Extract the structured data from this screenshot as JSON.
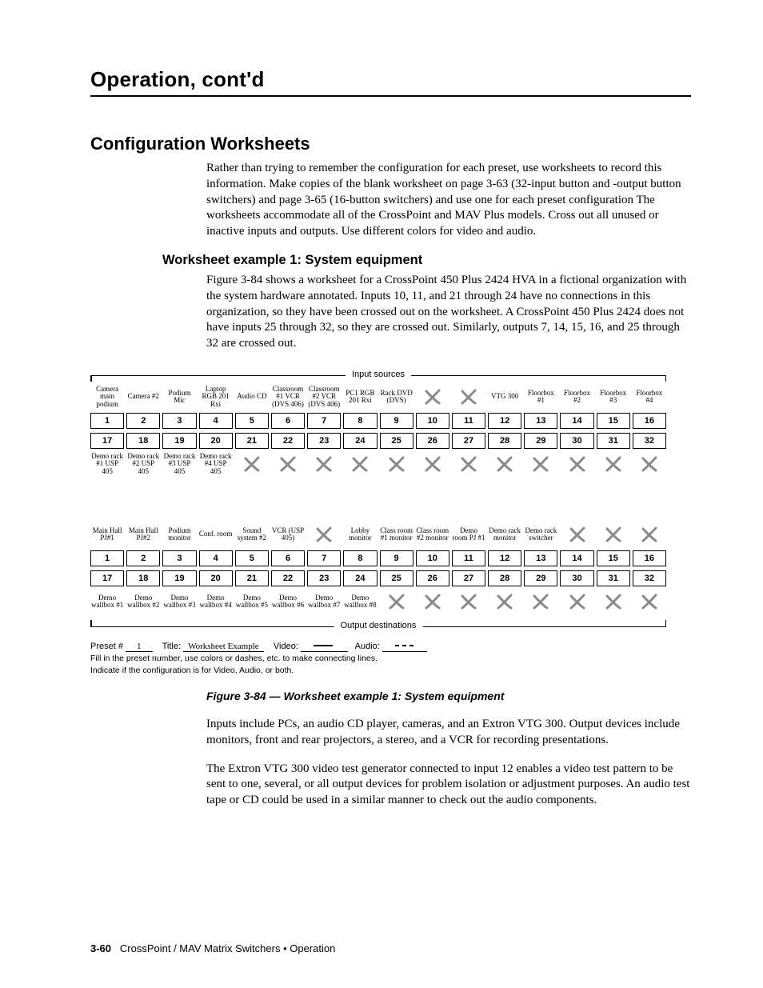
{
  "header": {
    "title": "Operation, cont'd"
  },
  "sec": {
    "h2": "Configuration Worksheets",
    "p1": "Rather than trying to remember the configuration for each preset, use worksheets to record this information.  Make copies of the blank worksheet on page 3-63 (32-input button and -output button switchers) and page 3-65 (16-button switchers) and use one for each preset configuration  The worksheets accommodate all of the CrossPoint and MAV Plus models.  Cross out all unused or inactive inputs and outputs.  Use different colors for video and audio.",
    "h3": "Worksheet example 1: System equipment",
    "p2": "Figure 3-84 shows a worksheet for a CrossPoint 450 Plus 2424 HVA in a fictional organization with the system hardware annotated.  Inputs 10, 11, and 21 through 24 have no connections in this organization, so they have been crossed out on the worksheet.  A CrossPoint 450 Plus 2424 does not have inputs 25 through 32, so they are crossed out.  Similarly, outputs 7, 14, 15, 16, and 25 through 32 are crossed out.",
    "caption": "Figure 3-84 — Worksheet example 1: System equipment",
    "p3": "Inputs include PCs, an audio CD player, cameras, and an Extron VTG 300.  Output devices include monitors, front and rear projectors, a stereo, and a VCR for recording presentations.",
    "p4": "The Extron VTG 300 video test generator connected to input 12 enables a video test pattern to be sent to one, several, or all output devices for problem isolation or adjustment purposes.  An audio test tape or CD could be used in a similar manner to check out the audio components."
  },
  "ws": {
    "input_lbl": "Input sources",
    "output_lbl": "Output destinations",
    "input_top": [
      "Camera main podium",
      "Camera #2",
      "Podium Mic",
      "Laptop RGB 201 Rxi",
      "Audio CD",
      "Classroom #1 VCR (DVS 406)",
      "Classroom #2 VCR (DVS 406)",
      "PC1 RGB 201 Rxi",
      "Rack DVD (DVS)",
      "X",
      "X",
      "VTG 300",
      "Floorbox #1",
      "Floorbox #2",
      "Floorbox #3",
      "Floorbox #4"
    ],
    "row1": [
      "1",
      "2",
      "3",
      "4",
      "5",
      "6",
      "7",
      "8",
      "9",
      "10",
      "11",
      "12",
      "13",
      "14",
      "15",
      "16"
    ],
    "row2": [
      "17",
      "18",
      "19",
      "20",
      "21",
      "22",
      "23",
      "24",
      "25",
      "26",
      "27",
      "28",
      "29",
      "30",
      "31",
      "32"
    ],
    "input_bot": [
      "Demo rack #1 USP 405",
      "Demo rack #2 USP 405",
      "Demo rack #3 USP 405",
      "Demo rack #4 USP 405",
      "X",
      "X",
      "X",
      "X",
      "X",
      "X",
      "X",
      "X",
      "X",
      "X",
      "X",
      "X"
    ],
    "output_top": [
      "Main Hall PJ#1",
      "Main Hall PJ#2",
      "Podium monitor",
      "Conf. room",
      "Sound system #2",
      "VCR (USP 405)",
      "X",
      "Lobby monitor",
      "Class room #1 monitor",
      "Class room #2 monitor",
      "Demo room PJ #1",
      "Demo rack monitor",
      "Demo rack switcher",
      "X",
      "X",
      "X"
    ],
    "output_bot": [
      "Demo wallbox #1",
      "Demo wallbox #2",
      "Demo wallbox #3",
      "Demo wallbox #4",
      "Demo wallbox #5",
      "Demo wallbox #6",
      "Demo wallbox #7",
      "Demo wallbox #8",
      "X",
      "X",
      "X",
      "X",
      "X",
      "X",
      "X",
      "X"
    ],
    "preset_lbl": "Preset #",
    "preset_val": "1",
    "title_lbl": "Title:",
    "title_val": "Worksheet Example",
    "video_lbl": "Video:",
    "audio_lbl": "Audio:",
    "note1": "Fill in the preset number, use colors or dashes, etc. to make connecting lines.",
    "note2": "Indicate if the configuration is for Video, Audio, or both."
  },
  "footer": {
    "page": "3-60",
    "title": "CrossPoint / MAV Matrix Switchers • Operation"
  }
}
